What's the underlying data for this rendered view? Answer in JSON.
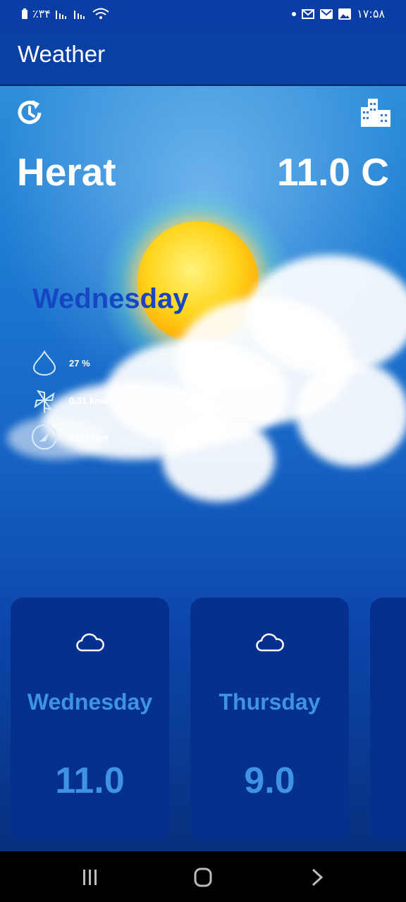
{
  "status_bar": {
    "battery": "٪۳۴",
    "time": "۱۷:۵۸"
  },
  "app_bar": {
    "title": "Weather"
  },
  "current": {
    "city": "Herat",
    "temperature": "11.0 C",
    "day": "Wednesday",
    "humidity": "27 %",
    "wind": "0.31 km/hr",
    "pressure": "1021 hpa"
  },
  "forecast": [
    {
      "day": "Wednesday",
      "temp": "11.0",
      "icon": "cloud-icon"
    },
    {
      "day": "Thursday",
      "temp": "9.0",
      "icon": "cloud-icon"
    }
  ],
  "icons": {
    "refresh": "refresh-history-icon",
    "city": "city-buildings-icon",
    "humidity": "water-drop-icon",
    "wind": "pinwheel-icon",
    "pressure": "gauge-icon"
  },
  "colors": {
    "app_bar": "#0a3fa3",
    "day_name": "#1546c4",
    "card_bg": "#06308d",
    "card_text": "#3f93e6"
  }
}
